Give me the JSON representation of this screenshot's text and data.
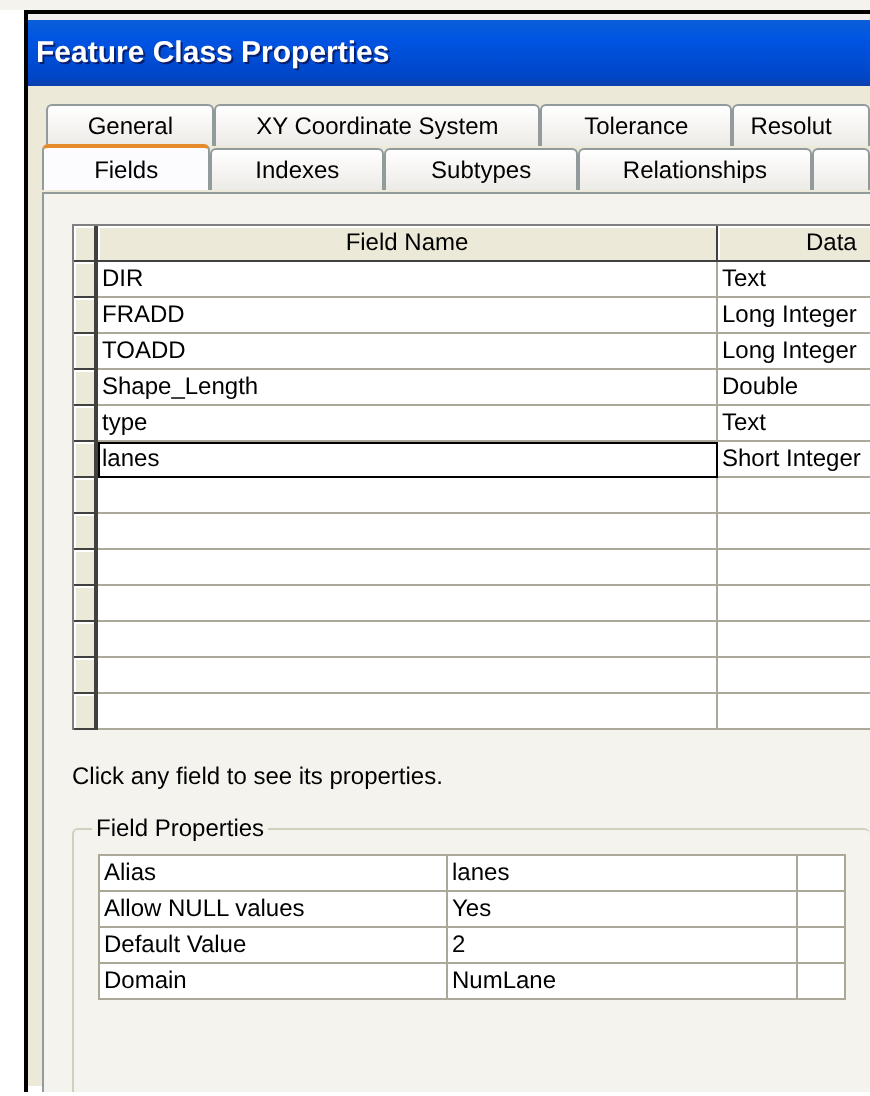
{
  "window": {
    "title": "Feature Class Properties"
  },
  "tabs": {
    "row_1": [
      {
        "label": "General",
        "selected": false
      },
      {
        "label": "XY Coordinate System",
        "selected": false
      },
      {
        "label": "Tolerance",
        "selected": false
      },
      {
        "label": "Resolut",
        "selected": false
      }
    ],
    "row_2": [
      {
        "label": "Fields",
        "selected": true
      },
      {
        "label": "Indexes",
        "selected": false
      },
      {
        "label": "Subtypes",
        "selected": false
      },
      {
        "label": "Relationships",
        "selected": false
      }
    ]
  },
  "fields_table": {
    "columns": [
      "Field Name",
      "Data"
    ],
    "rows": [
      {
        "cells": [
          "DIR",
          "Text"
        ],
        "selected": false
      },
      {
        "cells": [
          "FRADD",
          "Long Integer"
        ],
        "selected": false
      },
      {
        "cells": [
          "TOADD",
          "Long Integer"
        ],
        "selected": false
      },
      {
        "cells": [
          "Shape_Length",
          "Double"
        ],
        "selected": false
      },
      {
        "cells": [
          "type",
          "Text"
        ],
        "selected": false
      },
      {
        "cells": [
          "lanes",
          "Short Integer"
        ],
        "selected": true
      }
    ]
  },
  "hint": "Click any field to see its properties.",
  "field_properties": {
    "title": "Field Properties",
    "rows": [
      {
        "name": "Alias",
        "value": "lanes"
      },
      {
        "name": "Allow NULL values",
        "value": "Yes"
      },
      {
        "name": "Default Value",
        "value": "2"
      },
      {
        "name": "Domain",
        "value": "NumLane"
      }
    ]
  }
}
